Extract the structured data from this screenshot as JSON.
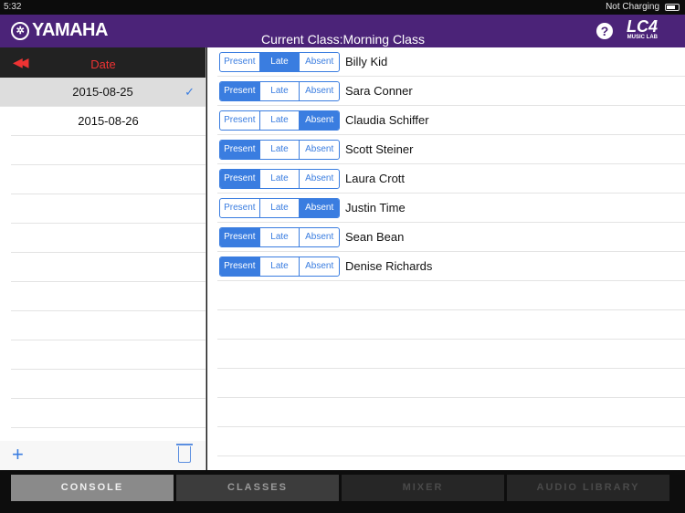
{
  "status": {
    "time": "5:32",
    "charging": "Not Charging"
  },
  "header": {
    "brand": "YAMAHA",
    "title": "Current Class:Morning Class",
    "help": "?",
    "logo": "LC4",
    "logo_sub": "MUSIC LAB"
  },
  "dates": {
    "title": "Date",
    "items": [
      {
        "label": "2015-08-25",
        "selected": true
      },
      {
        "label": "2015-08-26",
        "selected": false
      }
    ],
    "check": "✓",
    "add": "+"
  },
  "segment_labels": [
    "Present",
    "Late",
    "Absent"
  ],
  "students": [
    {
      "name": "Billy Kid",
      "status": "Late"
    },
    {
      "name": "Sara Conner",
      "status": "Present"
    },
    {
      "name": "Claudia Schiffer",
      "status": "Absent"
    },
    {
      "name": "Scott Steiner",
      "status": "Present"
    },
    {
      "name": "Laura Crott",
      "status": "Present"
    },
    {
      "name": "Justin Time",
      "status": "Absent"
    },
    {
      "name": "Sean Bean",
      "status": "Present"
    },
    {
      "name": "Denise Richards",
      "status": "Present"
    }
  ],
  "tabs": [
    {
      "label": "CONSOLE",
      "bg": "#8a8a8a",
      "fg": "#f0f0f0"
    },
    {
      "label": "CLASSES",
      "bg": "#3c3c3c",
      "fg": "#9a9a9a"
    },
    {
      "label": "MIXER",
      "bg": "#262626",
      "fg": "#4a4a4a"
    },
    {
      "label": "AUDIO LIBRARY",
      "bg": "#262626",
      "fg": "#4a4a4a"
    }
  ],
  "colors": {
    "accent": "#3a7de0",
    "header": "#4b2378",
    "date": "#e33333"
  }
}
